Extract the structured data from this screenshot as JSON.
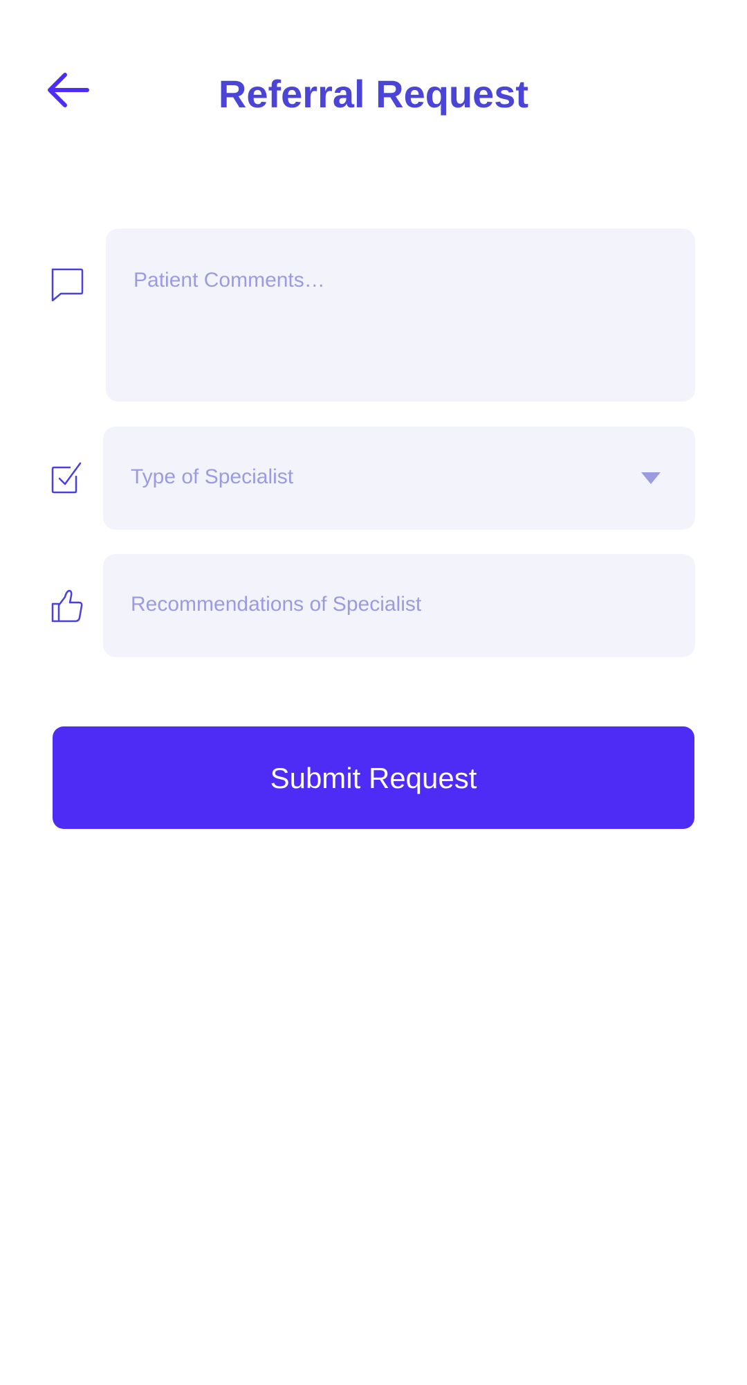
{
  "header": {
    "title": "Referral Request",
    "back_icon": "arrow-left-icon"
  },
  "form": {
    "patient_comments": {
      "icon": "chat-bubble-icon",
      "placeholder": "Patient Comments…"
    },
    "specialist_type": {
      "icon": "checkbox-checked-icon",
      "placeholder": "Type of Specialist",
      "dropdown_icon": "caret-down-icon"
    },
    "recommendations": {
      "icon": "thumbs-up-icon",
      "placeholder": "Recommendations of Specialist"
    }
  },
  "actions": {
    "submit_label": "Submit Request"
  },
  "colors": {
    "accent": "#4f2cf5",
    "title": "#4a45d6",
    "field_bg": "#f3f4fb",
    "placeholder": "#9a9be0",
    "icon_stroke": "#4a3fe0"
  }
}
